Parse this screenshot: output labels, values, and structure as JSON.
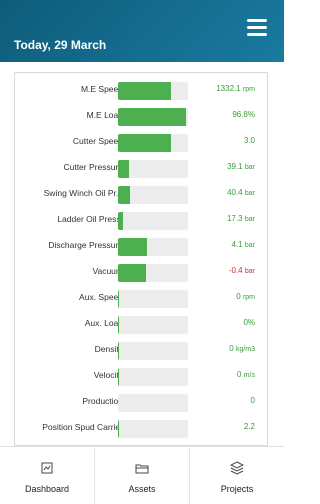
{
  "header": {
    "date": "Today, 29 March"
  },
  "rows": [
    {
      "label": "M.E Speed",
      "fill": 0.76,
      "value": "1332.1",
      "unit": "rpm",
      "negative": false
    },
    {
      "label": "M.E Load",
      "fill": 0.968,
      "value": "96.8%",
      "unit": "",
      "negative": false
    },
    {
      "label": "Cutter Speed",
      "fill": 0.76,
      "value": "3.0",
      "unit": "",
      "negative": false
    },
    {
      "label": "Cutter Pressure",
      "fill": 0.16,
      "value": "39.1",
      "unit": "bar",
      "negative": false
    },
    {
      "label": "Swing Winch Oil Pr...",
      "fill": 0.17,
      "value": "40.4",
      "unit": "bar",
      "negative": false
    },
    {
      "label": "Ladder Oil Press.",
      "fill": 0.07,
      "value": "17.3",
      "unit": "bar",
      "negative": false
    },
    {
      "label": "Discharge Pressure",
      "fill": 0.42,
      "value": "4.1",
      "unit": "bar",
      "negative": false
    },
    {
      "label": "Vacuum",
      "fill": 0.4,
      "value": "-0.4",
      "unit": "bar",
      "negative": true
    },
    {
      "label": "Aux. Speed",
      "fill": 0.02,
      "value": "0",
      "unit": "rpm",
      "negative": false
    },
    {
      "label": "Aux. Load",
      "fill": 0.02,
      "value": "0%",
      "unit": "",
      "negative": false
    },
    {
      "label": "Density",
      "fill": 0.02,
      "value": "0",
      "unit": "kg/m3",
      "negative": false
    },
    {
      "label": "Velocity",
      "fill": 0.02,
      "value": "0",
      "unit": "m/s",
      "negative": false
    },
    {
      "label": "Production",
      "fill": 0.0,
      "value": "0",
      "unit": "",
      "negative": false
    },
    {
      "label": "Position Spud Carrier",
      "fill": 0.02,
      "value": "2.2",
      "unit": "",
      "negative": false
    }
  ],
  "footer": {
    "tabs": [
      {
        "label": "Dashboard",
        "icon": "dashboard-icon"
      },
      {
        "label": "Assets",
        "icon": "assets-icon"
      },
      {
        "label": "Projects",
        "icon": "projects-icon"
      }
    ]
  },
  "colors": {
    "header": "#1a7aa0",
    "bar": "#4caf50",
    "value": "#3a9c3a",
    "negative": "#d32f2f"
  }
}
